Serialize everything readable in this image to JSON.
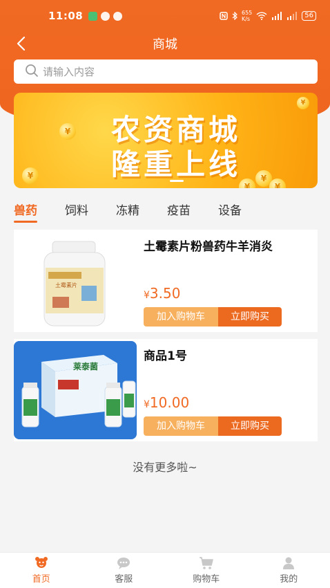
{
  "status_bar": {
    "time": "11:08",
    "net_speed_top": "655",
    "net_speed_unit": "K/s",
    "battery": "56"
  },
  "nav": {
    "title": "商城",
    "back_icon": "chevron-left-icon"
  },
  "search": {
    "placeholder": "请输入内容",
    "value": "",
    "icon": "search-icon"
  },
  "banner": {
    "line1": "农资商城",
    "line2": "隆重上线"
  },
  "tabs": [
    {
      "label": "兽药",
      "active": true
    },
    {
      "label": "饲料",
      "active": false
    },
    {
      "label": "冻精",
      "active": false
    },
    {
      "label": "疫苗",
      "active": false
    },
    {
      "label": "设备",
      "active": false
    }
  ],
  "products": [
    {
      "name": "土霉素片粉兽药牛羊消炎",
      "currency": "¥",
      "price": "3.50",
      "image_label": "土霉素片",
      "cart_label": "加入购物车",
      "buy_label": "立即购买"
    },
    {
      "name": "商品1号",
      "currency": "¥",
      "price": "10.00",
      "image_label": "莱泰菌",
      "cart_label": "加入购物车",
      "buy_label": "立即购买"
    }
  ],
  "no_more_text": "没有更多啦~",
  "bottom_nav": [
    {
      "label": "首页",
      "icon": "home-icon",
      "active": true
    },
    {
      "label": "客服",
      "icon": "chat-icon",
      "active": false
    },
    {
      "label": "购物车",
      "icon": "cart-icon",
      "active": false
    },
    {
      "label": "我的",
      "icon": "user-icon",
      "active": false
    }
  ],
  "colors": {
    "accent": "#f06a23",
    "cart_button": "#f7b05e",
    "buy_button": "#ec6a20"
  }
}
